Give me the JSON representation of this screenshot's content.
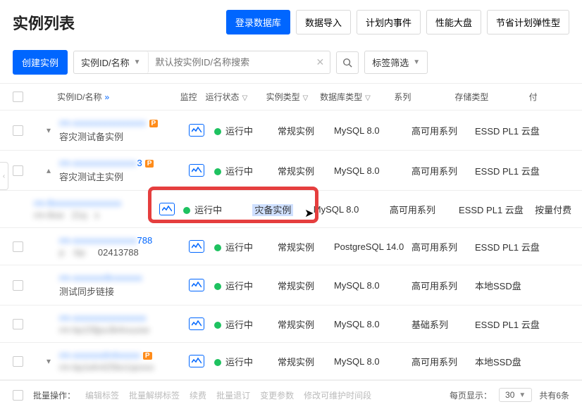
{
  "header": {
    "title": "实例列表",
    "actions": {
      "login_db": "登录数据库",
      "import": "数据导入",
      "schedule": "计划内事件",
      "perf": "性能大盘",
      "saving": "节省计划弹性型"
    }
  },
  "toolbar": {
    "create": "创建实例",
    "search_type": "实例ID/名称",
    "search_placeholder": "默认按实例ID/名称搜索",
    "tag_filter": "标签筛选"
  },
  "columns": {
    "name": "实例ID/名称",
    "monitor": "监控",
    "status": "运行状态",
    "itype": "实例类型",
    "dbtype": "数据库类型",
    "series": "系列",
    "storage": "存储类型",
    "billing": "付"
  },
  "rows": [
    {
      "expand": "v",
      "id": "",
      "alias": "容灾测试备实例",
      "badge": true,
      "status": "运行中",
      "itype": "常规实例",
      "db": "MySQL 8.0",
      "series": "高可用系列",
      "storage": "ESSD PL1 云盘"
    },
    {
      "expand": "^",
      "id": "",
      "alias": "容灾测试主实例",
      "badge": true,
      "id_suffix": "3",
      "status": "运行中",
      "itype": "常规实例",
      "db": "MySQL 8.0",
      "series": "高可用系列",
      "storage": "ESSD PL1 云盘"
    }
  ],
  "sub_row": {
    "id": "",
    "status": "运行中",
    "itype": "灾备实例",
    "db": "MySQL 8.0",
    "series": "高可用系列",
    "storage": "ESSD PL1 云盘",
    "billing": "按量付费"
  },
  "rows2": [
    {
      "id": "",
      "alias": "",
      "alias_suffix": "788",
      "id2": "02413788",
      "status": "运行中",
      "itype": "常规实例",
      "db": "PostgreSQL 14.0",
      "series": "高可用系列",
      "storage": "ESSD PL1 云盘"
    },
    {
      "id": "",
      "alias": "测试同步链接",
      "status": "运行中",
      "itype": "常规实例",
      "db": "MySQL 8.0",
      "series": "高可用系列",
      "storage": "本地SSD盘"
    },
    {
      "id": "",
      "alias": "",
      "status": "运行中",
      "itype": "常规实例",
      "db": "MySQL 8.0",
      "series": "基础系列",
      "storage": "ESSD PL1 云盘"
    },
    {
      "expand": "v",
      "id": "",
      "alias": "",
      "badge": true,
      "status": "运行中",
      "itype": "常规实例",
      "db": "MySQL 8.0",
      "series": "高可用系列",
      "storage": "本地SSD盘"
    }
  ],
  "batch": {
    "label": "批量操作：",
    "edit_tag": "编辑标签",
    "untag": "批量解绑标签",
    "renew": "续费",
    "logout": "批量退订",
    "change_params": "变更参数",
    "maintain": "修改可维护时间段"
  },
  "pagination": {
    "page_size_label": "每页显示：",
    "page_size": "30",
    "total_label": "共有6条"
  }
}
